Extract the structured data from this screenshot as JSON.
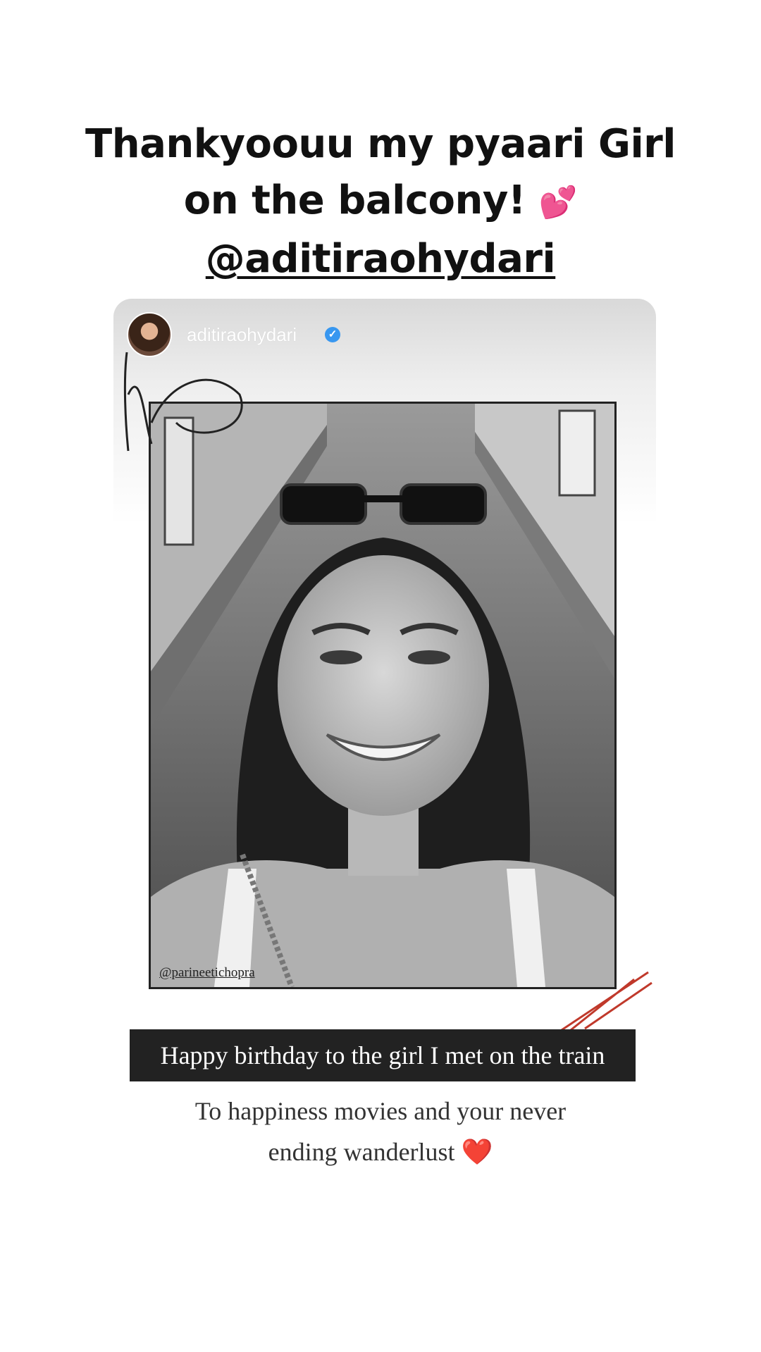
{
  "story": {
    "header": {
      "line1": "Thankyoouu my pyaari Girl",
      "line2": "on the balcony!",
      "emoji": "💕",
      "mention": "@aditiraohydari"
    },
    "shared_post": {
      "author": "aditiraohydari",
      "verified": true,
      "photo_credit": "@parineetichopra"
    },
    "caption": "Happy birthday to the girl I met on the train",
    "sub_caption": {
      "line1": "To happiness movies and your never",
      "line2": "ending wanderlust",
      "emoji": "❤️"
    },
    "colors": {
      "caption_bg": "#222222",
      "verified": "#3897f0",
      "scribble_red": "#c0392b"
    }
  }
}
